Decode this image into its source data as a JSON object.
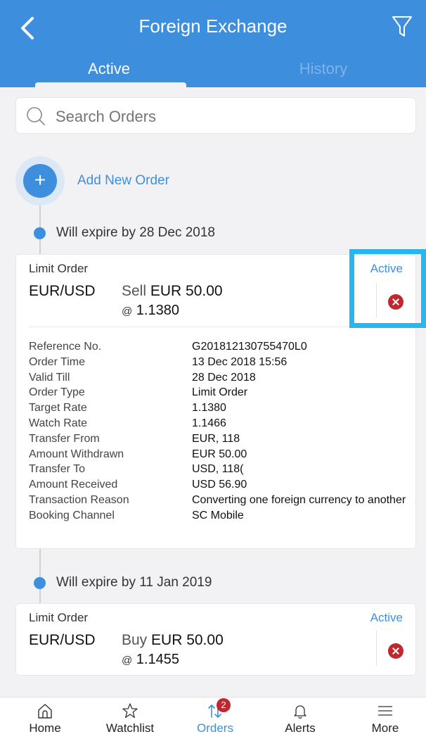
{
  "header": {
    "title": "Foreign Exchange",
    "tabs": [
      {
        "label": "Active",
        "active": true
      },
      {
        "label": "History",
        "active": false
      }
    ]
  },
  "search": {
    "placeholder": "Search Orders"
  },
  "add_order": {
    "label": "Add New Order"
  },
  "groups": [
    {
      "expiry": "Will expire by 28 Dec 2018",
      "order": {
        "type": "Limit Order",
        "status": "Active",
        "pair": "EUR/USD",
        "side": "Sell",
        "amount": "EUR 50.00",
        "rate_prefix": "@",
        "rate": "1.1380",
        "details": [
          {
            "label": "Reference No.",
            "value": "G201812130755470L0"
          },
          {
            "label": "Order Time",
            "value": "13 Dec 2018 15:56"
          },
          {
            "label": "Valid Till",
            "value": "28 Dec 2018"
          },
          {
            "label": "Order Type",
            "value": "Limit Order"
          },
          {
            "label": "Target Rate",
            "value": "1.1380"
          },
          {
            "label": "Watch Rate",
            "value": "1.1466"
          },
          {
            "label": "Transfer From",
            "value": "EUR, 118"
          },
          {
            "label": "Amount Withdrawn",
            "value": "EUR 50.00"
          },
          {
            "label": "Transfer To",
            "value": "USD, 118("
          },
          {
            "label": "Amount Received",
            "value": "USD 56.90"
          },
          {
            "label": "Transaction Reason",
            "value": "Converting one foreign currency to another"
          },
          {
            "label": "Booking Channel",
            "value": "SC Mobile"
          }
        ]
      }
    },
    {
      "expiry": "Will expire by 11 Jan 2019",
      "order": {
        "type": "Limit Order",
        "status": "Active",
        "pair": "EUR/USD",
        "side": "Buy",
        "amount": "EUR 50.00",
        "rate_prefix": "@",
        "rate": "1.1455"
      }
    }
  ],
  "nav": {
    "items": [
      {
        "label": "Home",
        "icon": "home-icon"
      },
      {
        "label": "Watchlist",
        "icon": "star-icon"
      },
      {
        "label": "Orders",
        "icon": "transfer-arrows-icon",
        "badge": "2",
        "active": true
      },
      {
        "label": "Alerts",
        "icon": "bell-icon"
      },
      {
        "label": "More",
        "icon": "menu-icon"
      }
    ]
  },
  "colors": {
    "accent": "#3d8fde",
    "cancel": "#c0282f",
    "highlight": "#29b6f0",
    "background": "#f2f2f4"
  }
}
